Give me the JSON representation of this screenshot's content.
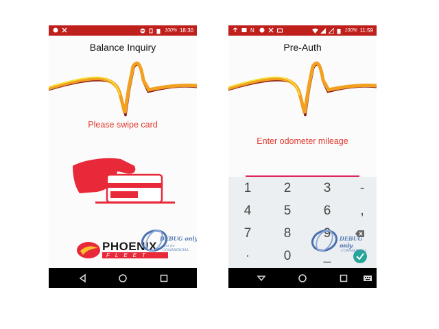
{
  "left_screen": {
    "status_time": "18:30",
    "status_battery": "100%",
    "title": "Balance Inquiry",
    "prompt": "Please swipe card",
    "logo": {
      "line1": "PHOENIX",
      "line2": "FLEET"
    },
    "watermark": {
      "line1": "DEBUG only",
      "line2": "Not for COMMERCIAL"
    }
  },
  "right_screen": {
    "status_time": "11:59",
    "status_battery": "100%",
    "title": "Pre-Auth",
    "prompt": "Enter odometer mileage",
    "keys": [
      "1",
      "2",
      "3",
      "-",
      "4",
      "5",
      "6",
      ",",
      "7",
      "8",
      "9",
      "",
      "·",
      "0",
      "_",
      ""
    ],
    "watermark": {
      "line1": "DEBUG only",
      "line2": "Not for COMMERCIAL"
    }
  },
  "colors": {
    "status_bar": "#c0201c",
    "prompt": "#e03a2e",
    "accent_check": "#26a69a"
  }
}
